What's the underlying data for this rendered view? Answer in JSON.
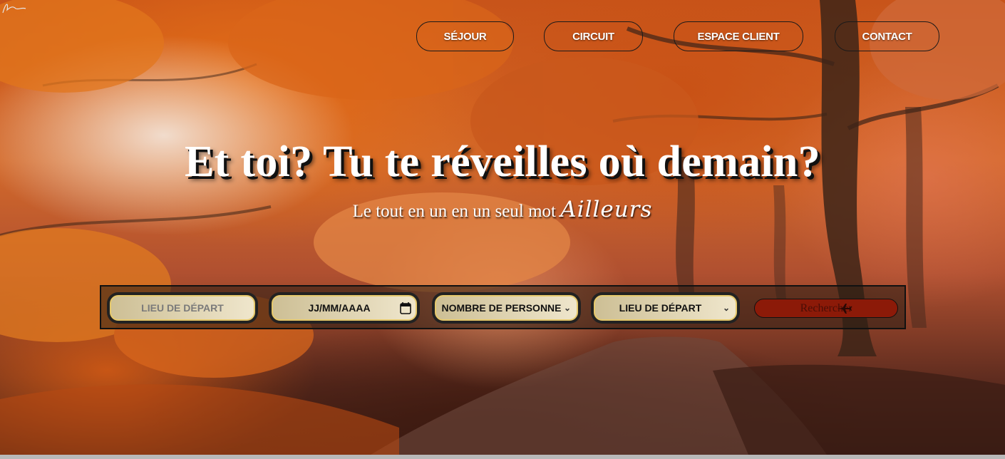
{
  "nav": {
    "items": [
      {
        "label": "SÉJOUR"
      },
      {
        "label": "CIRCUIT"
      },
      {
        "label": "ESPACE CLIENT"
      },
      {
        "label": "CONTACT"
      }
    ]
  },
  "hero": {
    "headline": "Et toi? Tu te réveilles où demain?",
    "subline": "Le tout en un en un seul mot",
    "brand_word": "Ailleurs"
  },
  "search": {
    "departure_placeholder": "LIEU DE DÉPART",
    "date_placeholder": "JJ/MM/AAAA",
    "persons_selected": "NOMBRE DE PERSONNE",
    "destination_selected": "LIEU DE DÉPART",
    "submit_label": "Rechercher",
    "submit_icon": "airplane-icon"
  },
  "colors": {
    "field_border": "#e6c96c",
    "button_bg": "#8c1a08",
    "text": "#ffffff"
  }
}
